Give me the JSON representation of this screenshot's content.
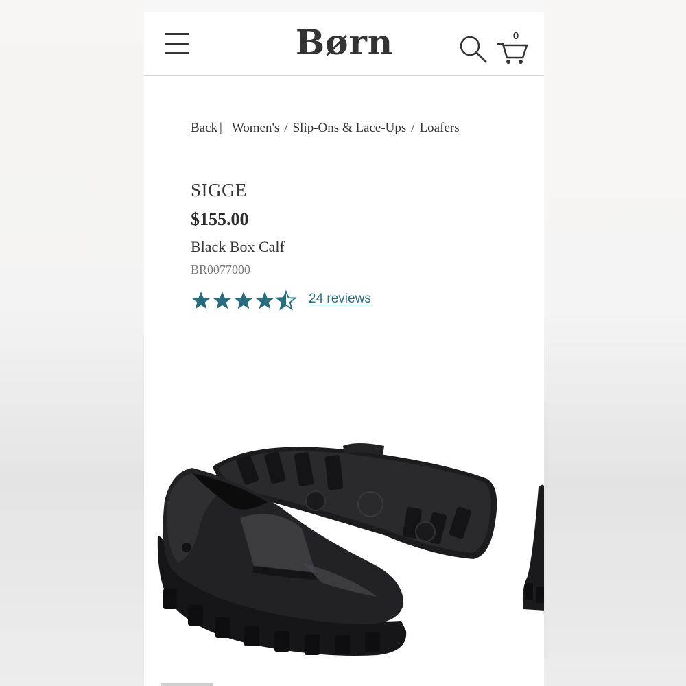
{
  "header": {
    "logo_text": "Børn",
    "cart_count": "0"
  },
  "breadcrumb": {
    "back": "Back",
    "divider": "|",
    "items": [
      "Women's",
      "Slip-Ons & Lace-Ups",
      "Loafers"
    ],
    "separator": "/"
  },
  "product": {
    "name": "SIGGE",
    "price": "$155.00",
    "color": "Black Box Calf",
    "sku": "BR0077000",
    "rating": 4.5,
    "reviews_label": "24 reviews"
  },
  "icons": {
    "menu": "hamburger-menu-icon",
    "search": "search-icon",
    "cart": "shopping-cart-icon",
    "star": "star-icon"
  },
  "colors": {
    "star": "#2a6d7f",
    "text": "#333333",
    "sku": "#777777",
    "divider": "#d6d6d6"
  }
}
